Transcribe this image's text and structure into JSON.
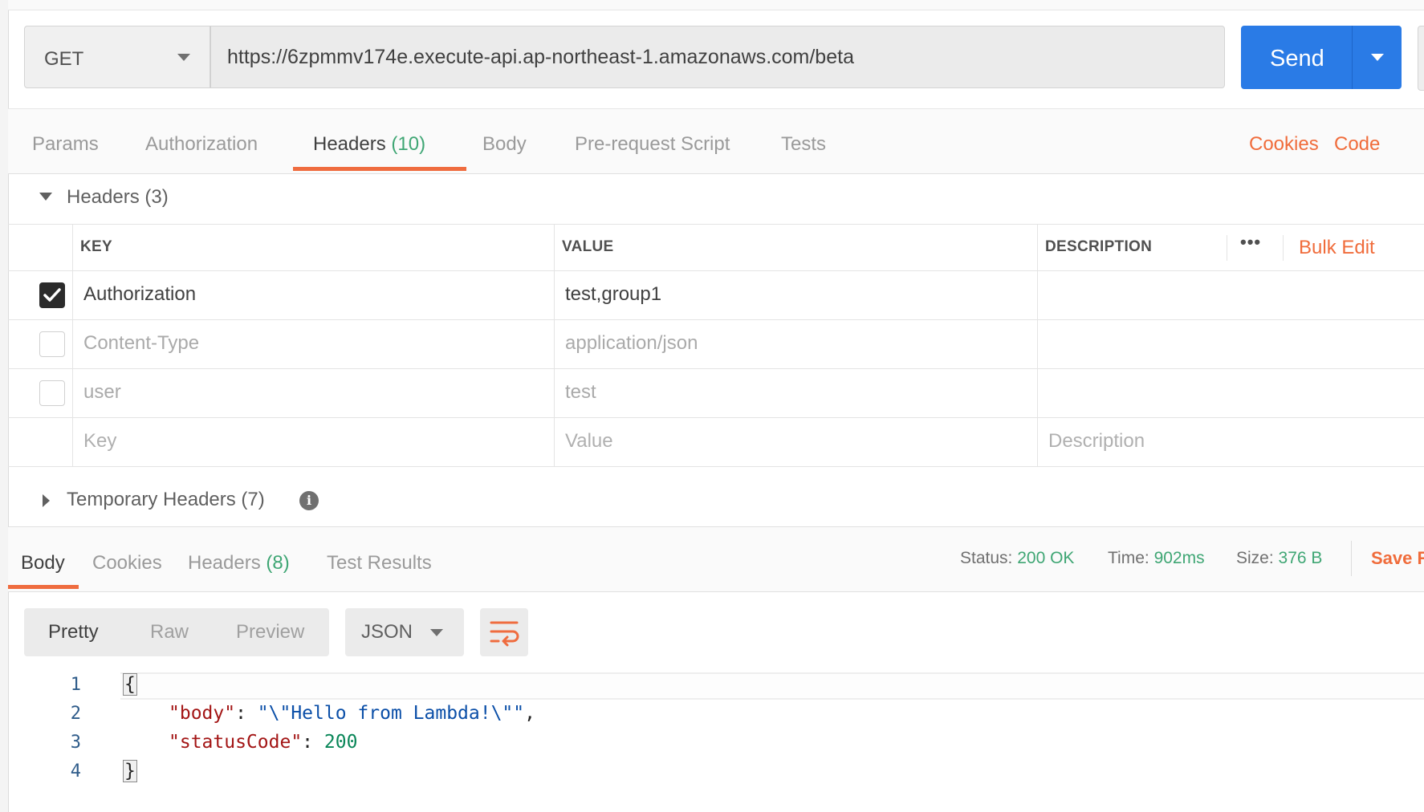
{
  "request": {
    "method": "GET",
    "url": "https://6zpmmv174e.execute-api.ap-northeast-1.amazonaws.com/beta",
    "send_label": "Send"
  },
  "request_tabs": [
    {
      "label": "Params",
      "count": ""
    },
    {
      "label": "Authorization",
      "count": ""
    },
    {
      "label": "Headers",
      "count": "(10)"
    },
    {
      "label": "Body",
      "count": ""
    },
    {
      "label": "Pre-request Script",
      "count": ""
    },
    {
      "label": "Tests",
      "count": ""
    }
  ],
  "request_links": {
    "cookies": "Cookies",
    "code": "Code"
  },
  "headers_section": {
    "title": "Headers",
    "count": "(3)",
    "columns": {
      "key": "KEY",
      "value": "VALUE",
      "description": "DESCRIPTION"
    },
    "more_icon": "•••",
    "bulk_edit": "Bulk Edit",
    "rows": [
      {
        "checked": true,
        "key": "Authorization",
        "value": "test,group1",
        "description": ""
      },
      {
        "checked": false,
        "key": "Content-Type",
        "value": "application/json",
        "description": ""
      },
      {
        "checked": false,
        "key": "user",
        "value": "test",
        "description": ""
      }
    ],
    "placeholder": {
      "key": "Key",
      "value": "Value",
      "description": "Description"
    }
  },
  "temporary_headers": {
    "title": "Temporary Headers",
    "count": "(7)",
    "info_icon": "i"
  },
  "response": {
    "tabs": [
      {
        "label": "Body",
        "count": ""
      },
      {
        "label": "Cookies",
        "count": ""
      },
      {
        "label": "Headers",
        "count": "(8)"
      },
      {
        "label": "Test Results",
        "count": ""
      }
    ],
    "status_label": "Status:",
    "status_value": "200 OK",
    "time_label": "Time:",
    "time_value": "902ms",
    "size_label": "Size:",
    "size_value": "376 B",
    "save_label": "Save R",
    "format_tabs": [
      "Pretty",
      "Raw",
      "Preview"
    ],
    "language": "JSON",
    "code": {
      "line_numbers": [
        "1",
        "2",
        "3",
        "4"
      ],
      "open_brace": "{",
      "close_brace": "}",
      "body_key": "\"body\"",
      "body_value": "\"\\\"Hello from Lambda!\\\"\"",
      "status_key": "\"statusCode\"",
      "status_value": "200"
    }
  },
  "colors": {
    "accent": "#ef6c3f",
    "send": "#2a7be6",
    "success": "#3fa674"
  }
}
